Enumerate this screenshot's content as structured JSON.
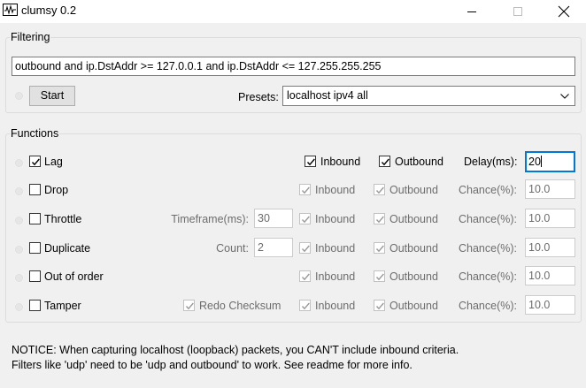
{
  "window": {
    "title": "clumsy 0.2",
    "icon": "waveform-icon"
  },
  "filtering": {
    "group_label": "Filtering",
    "filter_value": "outbound and ip.DstAddr >= 127.0.0.1 and ip.DstAddr <= 127.255.255.255",
    "start_label": "Start",
    "presets_label": "Presets:",
    "preset_selected": "localhost ipv4 all"
  },
  "functions": {
    "group_label": "Functions",
    "inbound_label": "Inbound",
    "outbound_label": "Outbound",
    "rows": [
      {
        "name": "Lag",
        "checked": true,
        "inbound": true,
        "outbound": true,
        "enabled": true,
        "param_label": "Delay(ms):",
        "param_value": "20"
      },
      {
        "name": "Drop",
        "checked": false,
        "inbound": true,
        "outbound": true,
        "enabled": false,
        "param_label": "Chance(%):",
        "param_value": "10.0"
      },
      {
        "name": "Throttle",
        "checked": false,
        "inbound": true,
        "outbound": true,
        "enabled": false,
        "extra_label": "Timeframe(ms):",
        "extra_value": "30",
        "param_label": "Chance(%):",
        "param_value": "10.0"
      },
      {
        "name": "Duplicate",
        "checked": false,
        "inbound": true,
        "outbound": true,
        "enabled": false,
        "extra_label": "Count:",
        "extra_value": "2",
        "param_label": "Chance(%):",
        "param_value": "10.0"
      },
      {
        "name": "Out of order",
        "checked": false,
        "inbound": true,
        "outbound": true,
        "enabled": false,
        "param_label": "Chance(%):",
        "param_value": "10.0"
      },
      {
        "name": "Tamper",
        "checked": false,
        "inbound": true,
        "outbound": true,
        "enabled": false,
        "extra_label": "Redo Checksum",
        "extra_checked": true,
        "param_label": "Chance(%):",
        "param_value": "10.0"
      }
    ]
  },
  "notice": {
    "line1": "NOTICE: When capturing localhost (loopback) packets, you CAN'T include inbound criteria.",
    "line2": "Filters like 'udp' need to be 'udp and outbound' to work. See readme for more info."
  }
}
